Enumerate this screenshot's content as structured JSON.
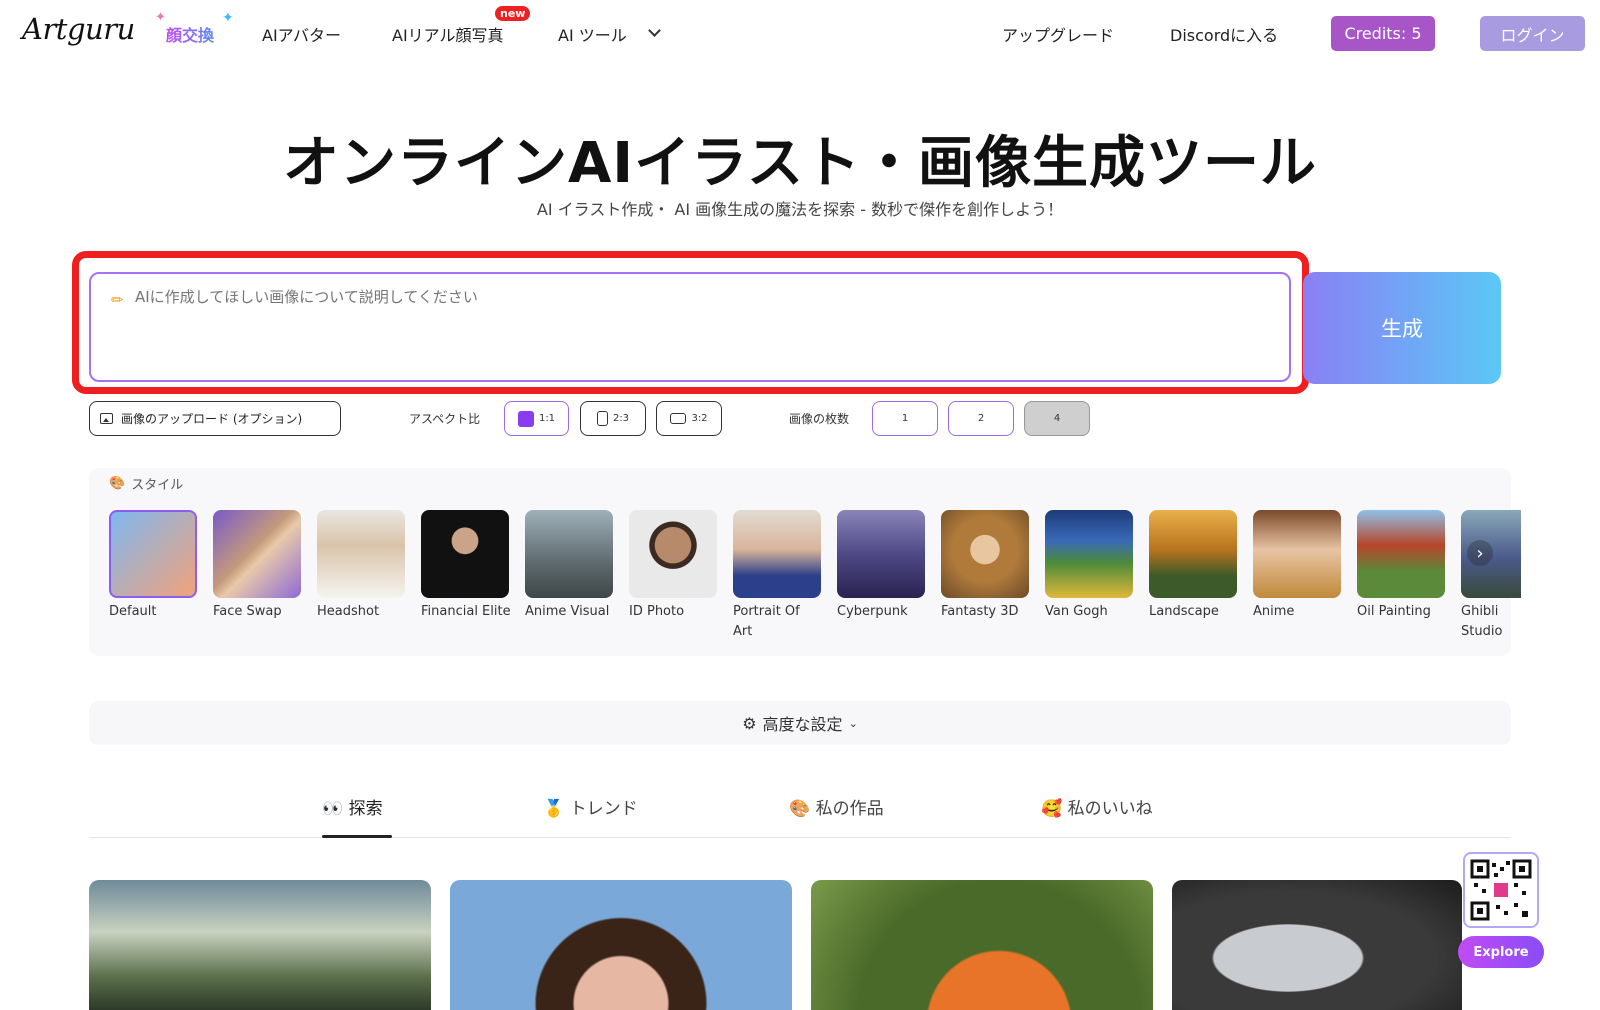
{
  "header": {
    "logo": "Artguru",
    "nav": {
      "face_swap": "顔交換",
      "ai_avatar": "AIアバター",
      "ai_photo": "AIリアル顔写真",
      "new_badge": "new",
      "ai_tools": "AI ツール"
    },
    "upgrade": "アップグレード",
    "discord": "Discordに入る",
    "credits": "Credits: 5",
    "login": "ログイン"
  },
  "hero": {
    "title": "オンラインAIイラスト・画像生成ツール",
    "subtitle": "AI イラスト作成・ AI 画像生成の魔法を探索 - 数秒で傑作を創作しよう！"
  },
  "prompt": {
    "placeholder": "AIに作成してほしい画像について説明してください",
    "generate": "生成"
  },
  "options": {
    "upload": "画像のアップロード (オプション)",
    "aspect_label": "アスペクト比",
    "aspects": [
      "1:1",
      "2:3",
      "3:2"
    ],
    "count_label": "画像の枚数",
    "counts": [
      "1",
      "2",
      "4"
    ]
  },
  "styles": {
    "heading": "スタイル",
    "items": [
      {
        "label": "Default"
      },
      {
        "label": "Face Swap"
      },
      {
        "label": "Headshot"
      },
      {
        "label": "Financial Elite"
      },
      {
        "label": "Anime Visual"
      },
      {
        "label": "ID Photo"
      },
      {
        "label": "Portrait Of Art"
      },
      {
        "label": "Cyberpunk"
      },
      {
        "label": "Fantasty 3D"
      },
      {
        "label": "Van Gogh"
      },
      {
        "label": "Landscape"
      },
      {
        "label": "Anime"
      },
      {
        "label": "Oil Painting"
      },
      {
        "label": "Ghibli Studio"
      }
    ]
  },
  "advanced": "高度な設定",
  "tabs": {
    "explore": "探索",
    "trend": "トレンド",
    "my_works": "私の作品",
    "my_likes": "私のいいね"
  },
  "explore_button": "Explore",
  "colors": {
    "accent": "#8b5cf6",
    "credits_bg": "#a855c7",
    "login_bg": "#a99be0",
    "highlight_frame": "#f01f1f"
  }
}
